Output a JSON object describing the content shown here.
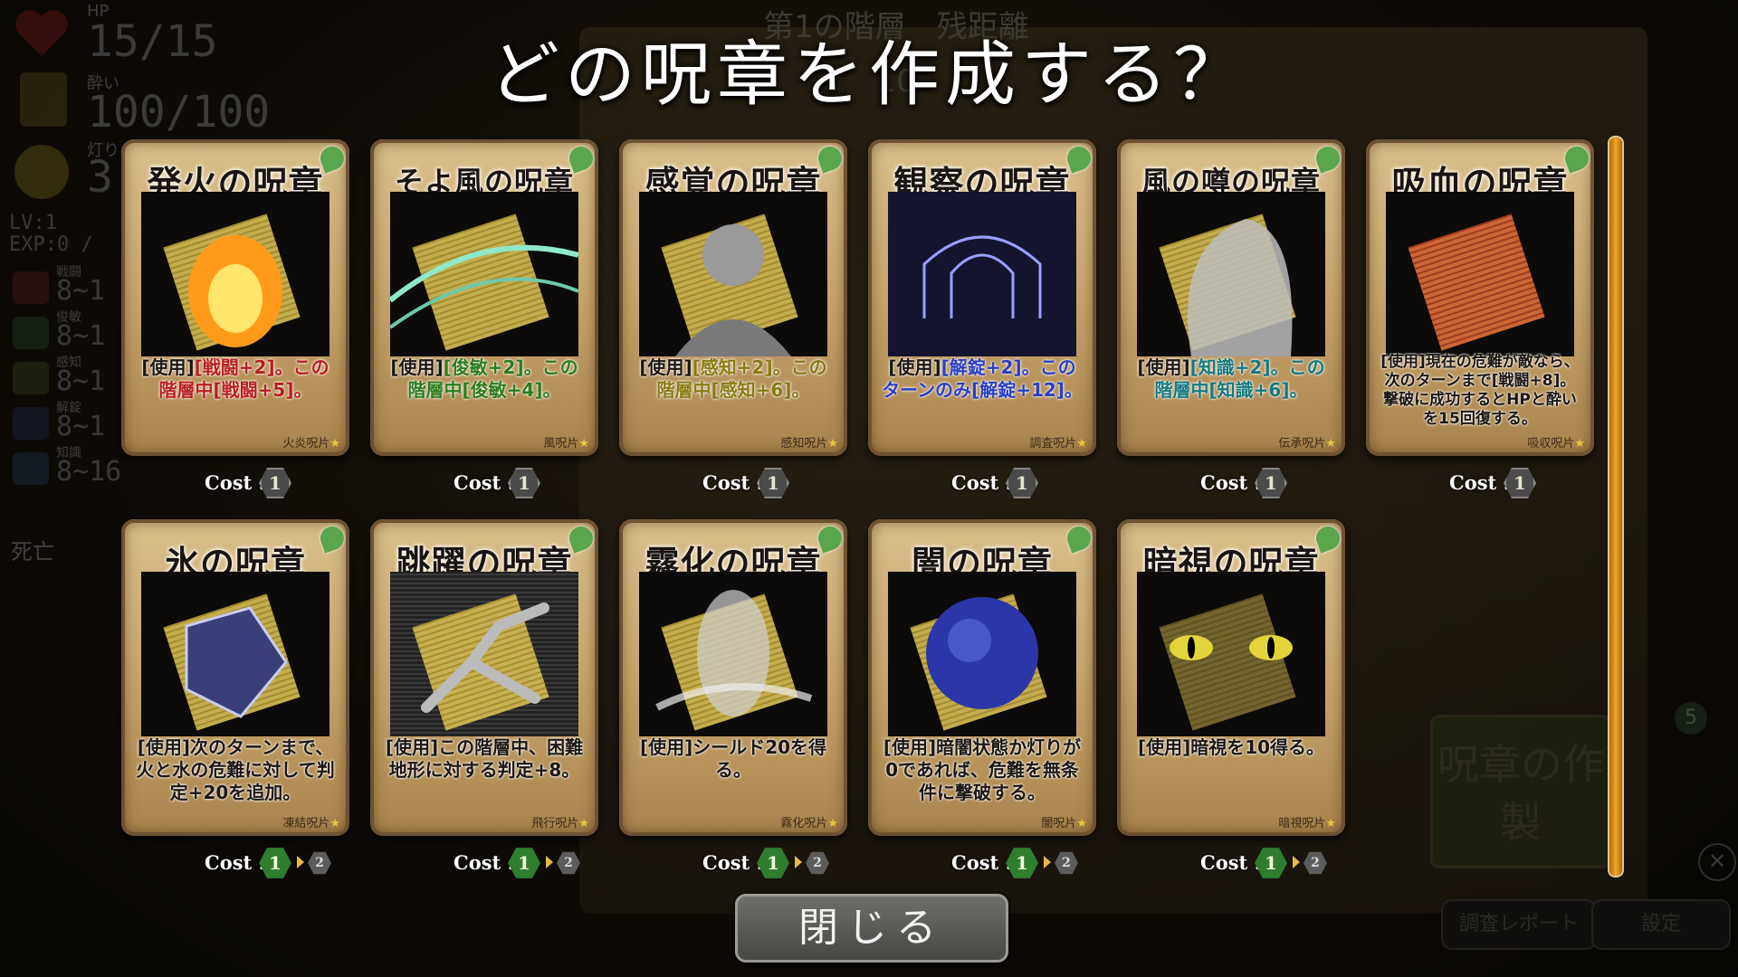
{
  "background": {
    "floor_text": "第1の階層　残距離　10",
    "hud": {
      "hp_label": "HP",
      "hp_value": "15/15",
      "drunk_label": "酔い",
      "drunk_value": "100/100",
      "light_label": "灯り",
      "light_value": "3",
      "level": "LV:1",
      "exp": "EXP:0 /",
      "stats": [
        {
          "label": "戦闘",
          "value": "8~1"
        },
        {
          "label": "俊敏",
          "value": "8~1"
        },
        {
          "label": "感知",
          "value": "8~1"
        },
        {
          "label": "解錠",
          "value": "8~1"
        },
        {
          "label": "知識",
          "value": "8~16"
        }
      ],
      "death_label": "死亡"
    },
    "craft_badge_count": "5",
    "craft_label": "呪章の作製",
    "report_button": "調査レポート",
    "settings_button": "設定"
  },
  "modal": {
    "title": "どの呪章を作成する？",
    "cost_label": "Cost :",
    "close_button": "閉じる",
    "cards": [
      {
        "name": "発火の呪章",
        "text_pre": "[使用]",
        "text": "[戦闘+2]。この階層中[戦闘+5]。",
        "type": "火炎呪片",
        "cost": "1"
      },
      {
        "name": "そよ風の呪章",
        "text_pre": "[使用]",
        "text": "[俊敏+2]。この階層中[俊敏+4]。",
        "type": "風呪片",
        "cost": "1"
      },
      {
        "name": "感覚の呪章",
        "text_pre": "[使用]",
        "text": "[感知+2]。この階層中[感知+6]。",
        "type": "感知呪片",
        "cost": "1"
      },
      {
        "name": "観察の呪章",
        "text_pre": "[使用]",
        "text": "[解錠+2]。このターンのみ[解錠+12]。",
        "type": "調査呪片",
        "cost": "1"
      },
      {
        "name": "風の噂の呪章",
        "text_pre": "[使用]",
        "text": "[知識+2]。この階層中[知識+6]。",
        "type": "伝承呪片",
        "cost": "1"
      },
      {
        "name": "吸血の呪章",
        "text_pre": "",
        "text": "[使用]現在の危難が敵なら、次のターンまで[戦闘+8]。撃破に成功するとHPと酔いを15回復する。",
        "type": "吸収呪片",
        "cost": "1"
      },
      {
        "name": "氷の呪章",
        "text_pre": "",
        "text": "[使用]次のターンまで、火と水の危難に対して判定+20を追加。",
        "type": "凍結呪片",
        "cost": "1",
        "cost_next": "2"
      },
      {
        "name": "跳躍の呪章",
        "text_pre": "",
        "text": "[使用]この階層中、困難地形に対する判定+8。",
        "type": "飛行呪片",
        "cost": "1",
        "cost_next": "2"
      },
      {
        "name": "霧化の呪章",
        "text_pre": "",
        "text": "[使用]シールド20を得る。",
        "type": "霧化呪片",
        "cost": "1",
        "cost_next": "2"
      },
      {
        "name": "闇の呪章",
        "text_pre": "",
        "text": "[使用]暗闇状態か灯りが0であれば、危難を無条件に撃破する。",
        "type": "闇呪片",
        "cost": "1",
        "cost_next": "2"
      },
      {
        "name": "暗視の呪章",
        "text_pre": "",
        "text": "[使用]暗視を10得る。",
        "type": "暗視呪片",
        "cost": "1",
        "cost_next": "2"
      }
    ]
  },
  "colors": {
    "card_parchment": "#c8a56c",
    "cost_green": "#2f7d2f",
    "scrollbar": "#f2a62b"
  }
}
